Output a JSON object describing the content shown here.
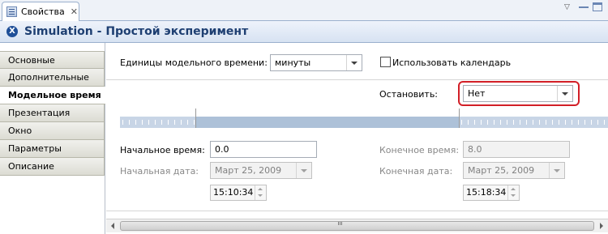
{
  "tab": {
    "label": "Свойства",
    "icon": "properties-icon",
    "close": "✕"
  },
  "window_controls": {
    "minimize": "▽",
    "maximize": "maximize-icon",
    "restore": "restore-icon"
  },
  "header": {
    "title": "Simulation - Простой эксперимент",
    "icon_glyph": "X"
  },
  "sidebar": {
    "items": [
      {
        "label": "Основные",
        "active": false
      },
      {
        "label": "Дополнительные",
        "active": false
      },
      {
        "label": "Модельное время",
        "active": true
      },
      {
        "label": "Презентация",
        "active": false
      },
      {
        "label": "Окно",
        "active": false
      },
      {
        "label": "Параметры",
        "active": false
      },
      {
        "label": "Описание",
        "active": false
      }
    ]
  },
  "form": {
    "time_units_label": "Единицы модельного времени:",
    "time_units_value": "минуты",
    "use_calendar_label": "Использовать календарь",
    "use_calendar_checked": false,
    "stop_label": "Остановить:",
    "stop_value": "Нет",
    "start_time_label": "Начальное время:",
    "start_time_value": "0.0",
    "end_time_label": "Конечное время:",
    "end_time_value": "8.0",
    "start_date_label": "Начальная дата:",
    "start_date_value": "Март 25, 2009",
    "end_date_label": "Конечная дата:",
    "end_date_value": "Март 25, 2009",
    "start_clock_value": "15:10:34",
    "end_clock_value": "15:18:34"
  },
  "colors": {
    "header_title": "#1e3f72",
    "highlight": "#d21f27",
    "timeline": "#adc1d8"
  }
}
